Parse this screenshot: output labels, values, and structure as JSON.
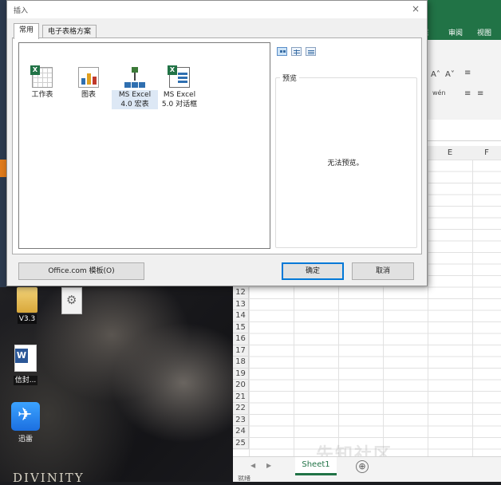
{
  "dialog": {
    "title": "插入",
    "close_glyph": "×",
    "tabs": [
      {
        "label": "常用",
        "active": true
      },
      {
        "label": "电子表格方案",
        "active": false
      }
    ],
    "templates": [
      {
        "icon": "worksheet-icon",
        "label_lines": [
          "工作表",
          ""
        ]
      },
      {
        "icon": "chart-icon",
        "label_lines": [
          "图表",
          ""
        ]
      },
      {
        "icon": "macro-sheet-icon",
        "label_lines": [
          "MS Excel",
          "4.0 宏表"
        ],
        "selected": true
      },
      {
        "icon": "dialog-sheet-icon",
        "label_lines": [
          "MS Excel",
          "5.0 对话框"
        ]
      }
    ],
    "view_modes": [
      "large-icons-view-icon",
      "list-view-icon",
      "details-view-icon"
    ],
    "preview": {
      "legend": "预览",
      "message": "无法预览。"
    },
    "buttons": {
      "office_templates": "Office.com 模板(O)",
      "ok": "确定",
      "cancel": "取消"
    }
  },
  "excel": {
    "ribbon_tabs": [
      "据",
      "审阅",
      "视图"
    ],
    "ribbon_glyphs": [
      "A˄",
      "A˅",
      "wén",
      "≡",
      "≡",
      "≡"
    ],
    "columns": [
      "E",
      "F"
    ],
    "rows": [
      "12",
      "13",
      "14",
      "15",
      "16",
      "17",
      "18",
      "19",
      "20",
      "21",
      "22",
      "23",
      "24",
      "25"
    ],
    "sheet_tab": "Sheet1",
    "add_sheet_glyph": "⊕",
    "status_text": "就绪",
    "watermark": "先知社区"
  },
  "desktop": {
    "icons": [
      {
        "icon": "folder-icon",
        "label": "V3.3"
      },
      {
        "icon": "settings-file-icon",
        "label": ""
      },
      {
        "icon": "word-document-icon",
        "label": "信封..."
      },
      {
        "icon": "xunlei-icon",
        "label": "迅雷"
      }
    ],
    "wallpaper_text": "DIVINITY"
  },
  "colors": {
    "excel_green": "#217346",
    "dialog_bg": "#f0f0f0",
    "default_button_border": "#0078d7"
  }
}
